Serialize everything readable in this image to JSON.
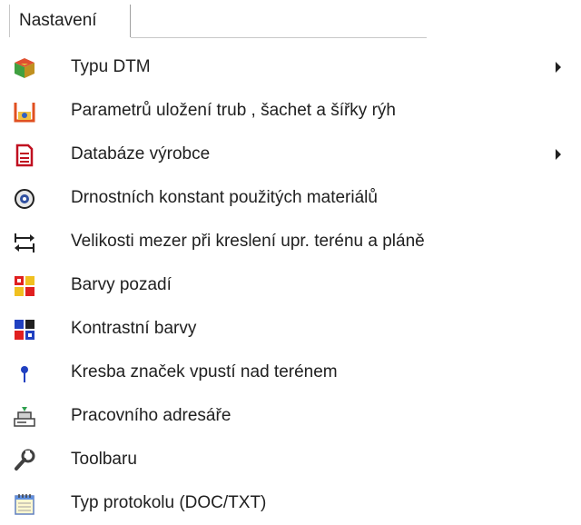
{
  "menubar": {
    "tab_label": "Nastavení"
  },
  "menu": {
    "items": [
      {
        "label": "Typu DTM",
        "icon": "dtm-cube-icon",
        "submenu": true
      },
      {
        "label": "Parametrů uložení trub , šachet a šířky rýh",
        "icon": "trench-pipe-icon",
        "submenu": false
      },
      {
        "label": "Databáze výrobce",
        "icon": "database-document-icon",
        "submenu": true
      },
      {
        "label": "Drnostních konstant použitých materiálů",
        "icon": "roughness-gauge-icon",
        "submenu": false
      },
      {
        "label": "Velikosti mezer  při kreslení  upr. terénu a pláně",
        "icon": "spacing-arrows-icon",
        "submenu": false
      },
      {
        "label": "Barvy pozadí",
        "icon": "background-colors-icon",
        "submenu": false
      },
      {
        "label": "Kontrastní barvy",
        "icon": "contrast-colors-icon",
        "submenu": false
      },
      {
        "label": "Kresba značek vpustí nad terénem",
        "icon": "pin-marker-icon",
        "submenu": false
      },
      {
        "label": "Pracovního adresáře",
        "icon": "working-directory-icon",
        "submenu": false
      },
      {
        "label": "Toolbaru",
        "icon": "wrench-icon",
        "submenu": false
      },
      {
        "label": "Typ protokolu (DOC/TXT)",
        "icon": "notepad-protocol-icon",
        "submenu": false
      }
    ]
  },
  "colors": {
    "text": "#202020",
    "background": "#ffffff",
    "border": "#c8c8c8"
  }
}
